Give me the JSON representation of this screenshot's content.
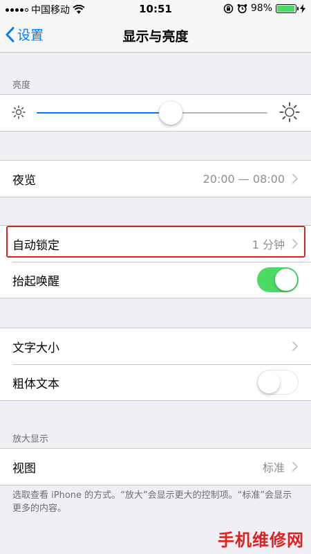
{
  "status_bar": {
    "carrier": "中国移动",
    "time": "10:51",
    "battery_percent": "98%",
    "battery_level": 0.98,
    "icons": [
      "signal-icon",
      "wifi-icon",
      "rotation-lock-icon",
      "alarm-icon",
      "battery-icon",
      "charging-icon"
    ]
  },
  "nav": {
    "back_label": "设置",
    "title": "显示与亮度"
  },
  "brightness": {
    "header": "亮度",
    "level": 0.58
  },
  "night_shift": {
    "label": "夜览",
    "value": "20:00 — 08:00"
  },
  "auto_lock": {
    "label": "自动锁定",
    "value": "1 分钟"
  },
  "raise_to_wake": {
    "label": "抬起唤醒",
    "on": true
  },
  "text_size": {
    "label": "文字大小"
  },
  "bold_text": {
    "label": "粗体文本",
    "on": false
  },
  "zoom": {
    "header": "放大显示",
    "view_label": "视图",
    "view_value": "标准",
    "footer": "选取查看 iPhone 的方式。“放大”会显示更大的控制项。“标准”会显示更多的内容。"
  },
  "watermark": "手机维修网",
  "colors": {
    "accent": "#007aff",
    "toggle_on": "#4cd964",
    "highlight": "#e02020",
    "background": "#efeff4"
  }
}
